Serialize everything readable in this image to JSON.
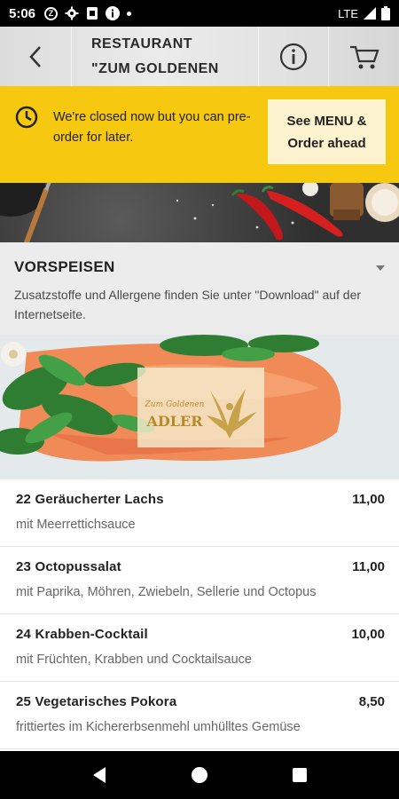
{
  "status_bar": {
    "time": "5:06",
    "network": "LTE"
  },
  "header": {
    "title_line1": "RESTAURANT",
    "title_line2": "\"ZUM GOLDENEN"
  },
  "notice": {
    "text": "We're closed now but you can pre-order for later.",
    "button_label": "See MENU & Order ahead",
    "button_line1": "See MENU &",
    "button_line2": "Order ahead",
    "color": "#f6c80f"
  },
  "section": {
    "title": "VORSPEISEN",
    "description": "Zusatzstoffe und Allergene finden Sie unter \"Download\" auf der Internetseite."
  },
  "logo": {
    "line1": "Zum Goldenen",
    "line2": "ADLER"
  },
  "menu_items": [
    {
      "name": "22 Geräucherter Lachs",
      "price": "11,00",
      "description": "mit Meerrettichsauce"
    },
    {
      "name": "23 Octopussalat",
      "price": "11,00",
      "description": "mit Paprika, Möhren, Zwiebeln, Sellerie und Octopus"
    },
    {
      "name": "24 Krabben-Cocktail",
      "price": "10,00",
      "description": "mit Früchten, Krabben und Cocktailsauce"
    },
    {
      "name": "25 Vegetarisches Pokora",
      "price": "8,50",
      "description": "frittiertes im Kichererbsenmehl umhülltes Gemüse"
    }
  ]
}
